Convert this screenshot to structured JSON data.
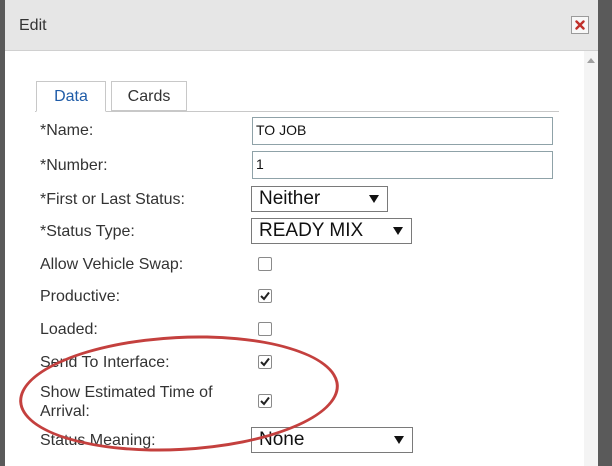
{
  "dialog": {
    "title": "Edit",
    "close_icon": "close-x-icon",
    "close_color": "#c0302a"
  },
  "tabs": [
    {
      "label": "Data",
      "active": true
    },
    {
      "label": "Cards",
      "active": false
    }
  ],
  "fields": {
    "name": {
      "label": "*Name:",
      "value": "TO JOB"
    },
    "number": {
      "label": "*Number:",
      "value": "1"
    },
    "first_last_status": {
      "label": "*First or Last Status:",
      "value": "Neither"
    },
    "status_type": {
      "label": "*Status Type:",
      "value": "READY MIX"
    },
    "allow_vehicle_swap": {
      "label": "Allow Vehicle Swap:",
      "checked": false
    },
    "productive": {
      "label": "Productive:",
      "checked": true
    },
    "loaded": {
      "label": "Loaded:",
      "checked": false
    },
    "send_to_interface": {
      "label": "Send To Interface:",
      "checked": true
    },
    "show_eta": {
      "label": "Show Estimated Time of Arrival:",
      "checked": true
    },
    "status_meaning": {
      "label": "Status Meaning:",
      "value": "None"
    }
  },
  "annotation": {
    "shape": "ellipse",
    "color": "#c4403e"
  },
  "colors": {
    "tab_active_text": "#1f5ca8",
    "backdrop": "#5a5a5a",
    "titlebar": "#e6e6e6"
  }
}
